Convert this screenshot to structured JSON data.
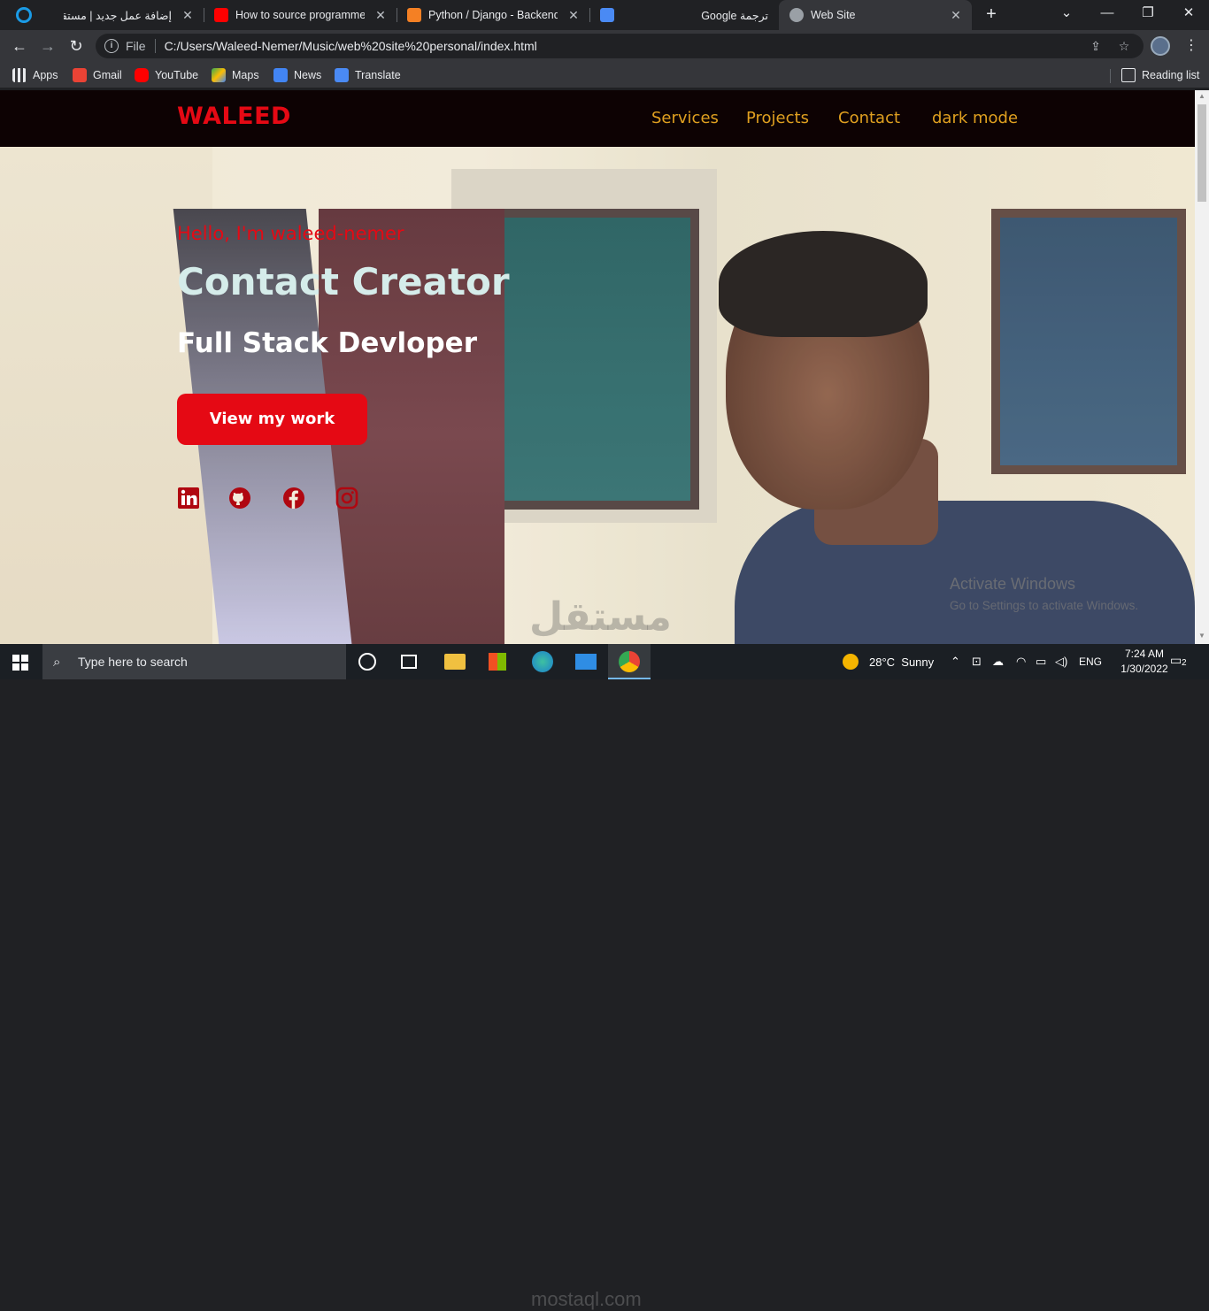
{
  "browser": {
    "tabs": [
      {
        "title": "إضافة عمل جديد | مستقل",
        "close": "✕"
      },
      {
        "title": "How to source programmers",
        "close": "✕"
      },
      {
        "title": "Python / Django - Backend D",
        "close": "✕"
      },
      {
        "title": "Google ترجمة",
        "close": "✕"
      },
      {
        "title": "Web Site",
        "close": "✕"
      }
    ],
    "new_tab": "+",
    "address": {
      "scheme": "File",
      "url": "C:/Users/Waleed-Nemer/Music/web%20site%20personal/index.html"
    },
    "bookmarks": [
      "Apps",
      "Gmail",
      "YouTube",
      "Maps",
      "News",
      "Translate"
    ],
    "reading_list": "Reading list"
  },
  "site": {
    "logo": "WALEED",
    "nav": [
      "Services",
      "Projects",
      "Contact",
      "dark mode"
    ],
    "hero": {
      "greeting": "Hello, I'm waleed-nemer",
      "title": "Contact Creator",
      "subtitle": "Full Stack Devloper",
      "cta": "View my work"
    },
    "social_icons": [
      "linkedin-icon",
      "github-icon",
      "facebook-icon",
      "instagram-icon"
    ],
    "accent_color": "#e50914",
    "nav_color": "#e0a020"
  },
  "overlay": {
    "activate_title": "Activate Windows",
    "activate_sub": "Go to Settings to activate Windows.",
    "watermark": "مستقل",
    "watermark_url": "mostaql.com"
  },
  "taskbar": {
    "search_placeholder": "Type here to search",
    "weather": "28°C  Sunny",
    "language": "ENG",
    "time": "7:24 AM",
    "date": "1/30/2022",
    "notifications": "2"
  }
}
